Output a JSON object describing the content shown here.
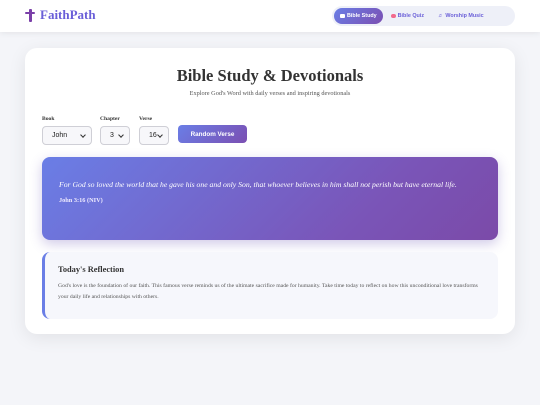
{
  "header": {
    "brand_name": "FaithPath",
    "nav": [
      {
        "label": "Bible Study",
        "icon": "book-icon",
        "active": true
      },
      {
        "label": "Bible Quiz",
        "icon": "brain-icon",
        "active": false
      },
      {
        "label": "Worship Music",
        "icon": "music-note-icon",
        "active": false
      }
    ]
  },
  "main": {
    "title": "Bible Study & Devotionals",
    "subtitle": "Explore God's Word with daily verses and inspiring devotionals",
    "selectors": {
      "book": {
        "label": "Book",
        "value": "John"
      },
      "chapter": {
        "label": "Chapter",
        "value": "3"
      },
      "verse": {
        "label": "Verse",
        "value": "16"
      }
    },
    "random_button": "Random Verse",
    "verse": {
      "text": "For God so loved the world that he gave his one and only Son, that whoever believes in him shall not perish but have eternal life.",
      "reference": "John 3:16 (NIV)"
    },
    "reflection": {
      "title": "Today's Reflection",
      "body": "God's love is the foundation of our faith. This famous verse reminds us of the ultimate sacrifice made for humanity. Take time today to reflect on how this unconditional love transforms your daily life and relationships with others."
    }
  },
  "colors": {
    "accent_start": "#6a7ee6",
    "accent_end": "#7b4fb2",
    "brand": "#6a5fd8",
    "cross": "#7a3fa8"
  }
}
